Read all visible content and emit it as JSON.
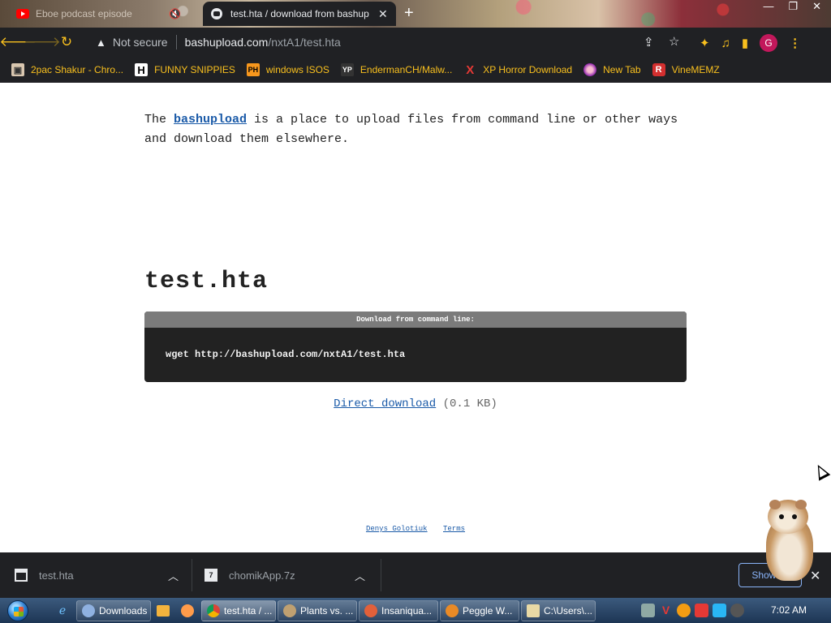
{
  "browser": {
    "tabs": [
      {
        "title": "Eboe podcast episode",
        "active": false
      },
      {
        "title": "test.hta / download from bashup",
        "active": true
      }
    ],
    "window_controls": [
      "—",
      "❐",
      "✕"
    ],
    "address": {
      "security_label": "Not secure",
      "host": "bashupload.com",
      "path": "/nxtA1/test.hta"
    },
    "profile_initial": "G",
    "bookmarks": [
      {
        "label": "2pac Shakur - Chro...",
        "icon": "photo"
      },
      {
        "label": "FUNNY SNIPPIES",
        "icon": "H"
      },
      {
        "label": "windows ISOS",
        "icon": "PH"
      },
      {
        "label": "EndermanCH/Malw...",
        "icon": "YP"
      },
      {
        "label": "XP Horror Download",
        "icon": "X"
      },
      {
        "label": "New Tab",
        "icon": "pinwheel"
      },
      {
        "label": "VineMEMZ",
        "icon": "R"
      }
    ]
  },
  "page": {
    "intro_pre": "The ",
    "intro_link": "bashupload",
    "intro_post": " is a place to upload files from command line or other ways and download them elsewhere.",
    "file_name": "test.hta",
    "cmd_header": "Download from command line:",
    "cmd_text": "wget http://bashupload.com/nxtA1/test.hta",
    "direct_download_label": "Direct download",
    "file_size": "(0.1 KB)",
    "footer_links": [
      "Denys Golotiuk",
      "Terms"
    ]
  },
  "downloads": {
    "items": [
      {
        "name": "test.hta"
      },
      {
        "name": "chomikApp.7z"
      }
    ],
    "show_all_label": "Show all"
  },
  "taskbar": {
    "tasks": [
      {
        "label": "Downloads",
        "color": "#8fb1e0"
      },
      {
        "label": "test.hta / ...",
        "color": "#f4b400"
      },
      {
        "label": "Plants vs. ...",
        "color": "#bfa071"
      },
      {
        "label": "Insaniqua...",
        "color": "#e2603a"
      },
      {
        "label": "Peggle W...",
        "color": "#e98a26"
      },
      {
        "label": "C:\\Users\\...",
        "color": "#e8d9a5"
      }
    ],
    "clock": "7:02 AM"
  },
  "colors": {
    "chrome_dark": "#202124",
    "accent_yellow": "#f9c01e",
    "link_blue": "#1a5aa8"
  }
}
